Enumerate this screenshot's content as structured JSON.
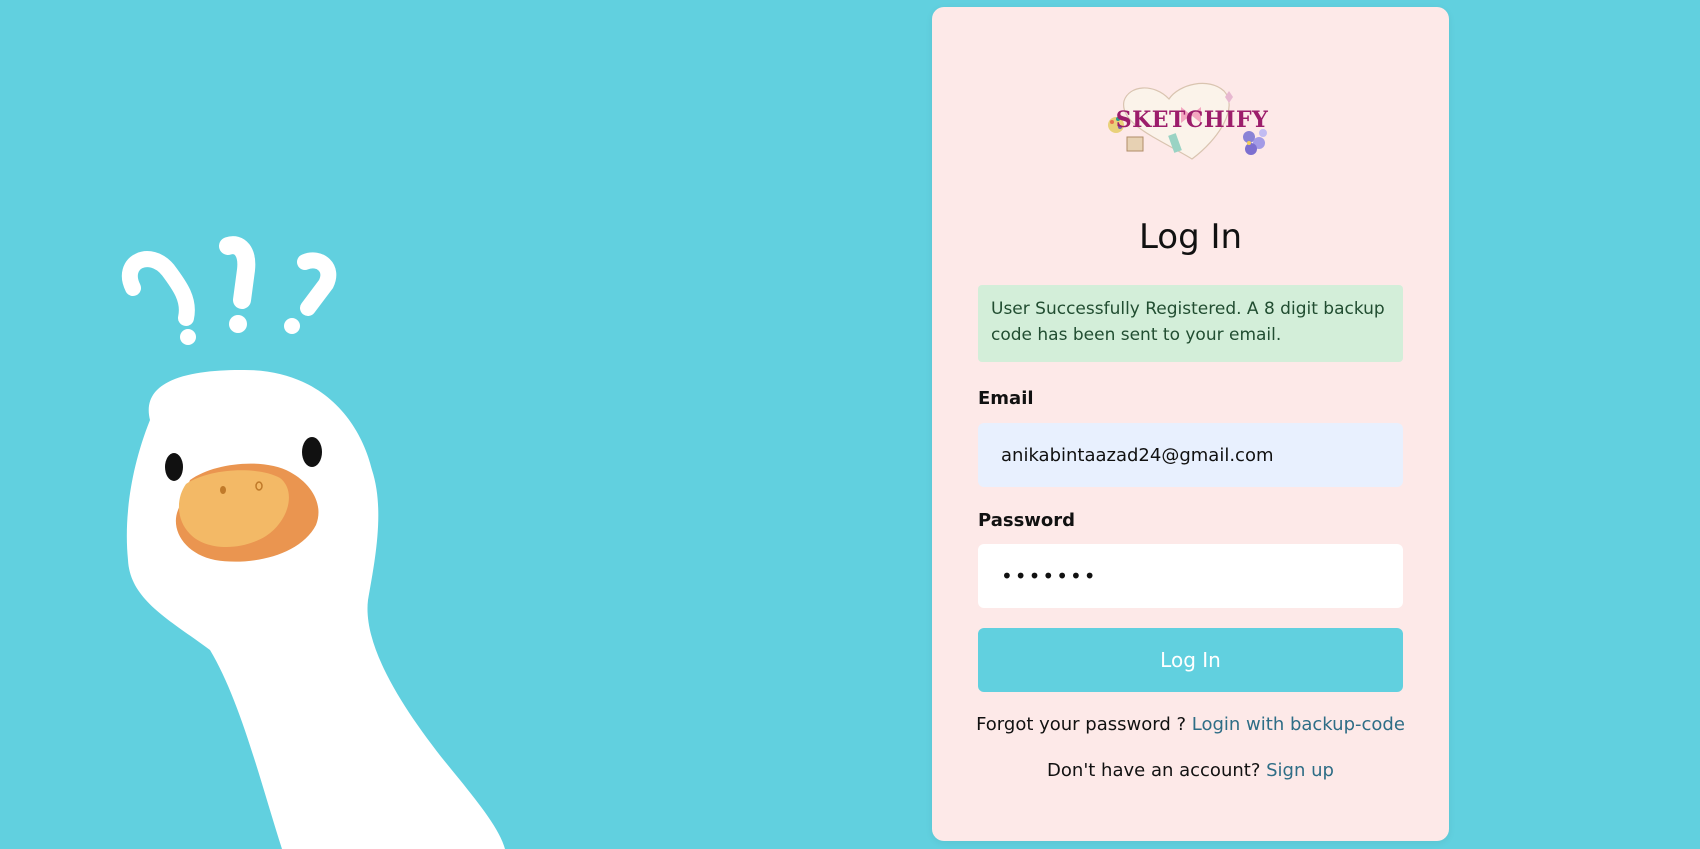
{
  "login": {
    "title": "Log In",
    "alert": "User Successfully Registered. A 8 digit backup code has been sent to your email.",
    "email_label": "Email",
    "email_value": "anikabintaazad24@gmail.com",
    "password_label": "Password",
    "password_value": "•••••••",
    "submit_label": "Log In",
    "forgot_text": "Forgot your password ?",
    "backup_link": "Login with backup-code",
    "signup_text": "Don't have an account?",
    "signup_link": "Sign up"
  },
  "logo": {
    "text": "SKETCHIFY"
  },
  "illustration": {
    "marks": "?!?"
  },
  "colors": {
    "background": "#61d0df",
    "card": "#fde9e8",
    "alert_bg": "#d3eed9",
    "button": "#61d0df",
    "link": "#2e6d86"
  }
}
